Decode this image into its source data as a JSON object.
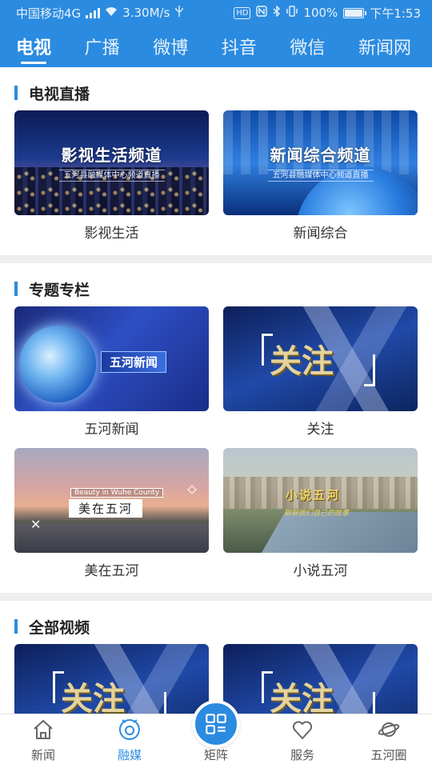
{
  "status_bar": {
    "carrier": "中国移动4G",
    "network_badge": "4G",
    "speed": "3.30M/s",
    "battery_percent": "100%",
    "battery_level": 1.0,
    "time": "下午1:53",
    "hd_badge": "HD",
    "icons": [
      "signal-icon",
      "wifi-icon",
      "usb-icon",
      "nfc-icon",
      "bluetooth-icon",
      "vibrate-icon",
      "battery-icon"
    ]
  },
  "top_tabs": [
    {
      "label": "电视",
      "active": true
    },
    {
      "label": "广播",
      "active": false
    },
    {
      "label": "微博",
      "active": false
    },
    {
      "label": "抖音",
      "active": false
    },
    {
      "label": "微信",
      "active": false
    },
    {
      "label": "新闻网",
      "active": false
    }
  ],
  "sections": {
    "live_tv": {
      "title": "电视直播",
      "items": [
        {
          "label": "影视生活",
          "thumb_title": "影视生活频道",
          "thumb_sub": "五河县融媒体中心频道直播"
        },
        {
          "label": "新闻综合",
          "thumb_title": "新闻综合频道",
          "thumb_sub": "五河县融媒体中心频道直播"
        }
      ]
    },
    "topics": {
      "title": "专题专栏",
      "items": [
        {
          "label": "五河新闻",
          "thumb_title": "五河新闻"
        },
        {
          "label": "关注",
          "thumb_title": "关注"
        },
        {
          "label": "美在五河",
          "thumb_title": "美在五河",
          "thumb_sub": "Beauty in Wuhe County"
        },
        {
          "label": "小说五河",
          "thumb_title": "小说五河",
          "thumb_sub": "聊聊我们自己的故事"
        }
      ]
    },
    "all_videos": {
      "title": "全部视频",
      "items": [
        {
          "thumb_title": "关注"
        },
        {
          "thumb_title": "关注"
        }
      ]
    }
  },
  "bottom_nav": [
    {
      "label": "新闻",
      "icon": "home-icon",
      "active": false
    },
    {
      "label": "融媒",
      "icon": "media-hub-icon",
      "active": true
    },
    {
      "label": "矩阵",
      "icon": "grid-matrix-icon",
      "active": false
    },
    {
      "label": "服务",
      "icon": "heart-icon",
      "active": false
    },
    {
      "label": "五河圈",
      "icon": "planet-icon",
      "active": false
    }
  ],
  "colors": {
    "primary": "#2b8be0",
    "section_bar": "#2b8be0",
    "divider": "#eeeeee"
  }
}
